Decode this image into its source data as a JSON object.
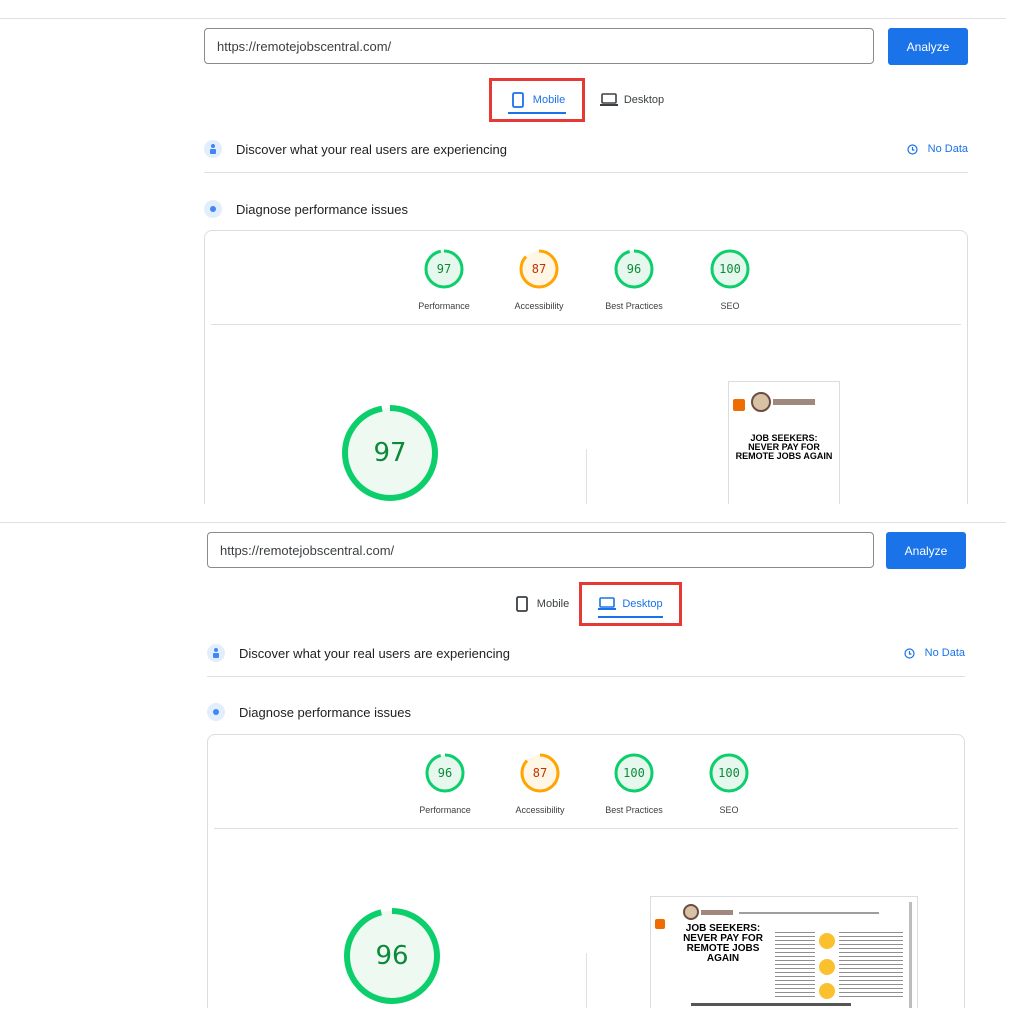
{
  "panels": [
    {
      "url": "https://remotejobscentral.com/",
      "analyze_label": "Analyze",
      "tabs": {
        "mobile": "Mobile",
        "desktop": "Desktop",
        "active": "mobile"
      },
      "sections": {
        "discover": "Discover what your real users are experiencing",
        "no_data": "No Data",
        "diagnose": "Diagnose performance issues"
      },
      "categories": [
        {
          "label": "Performance",
          "score": "97",
          "status": "good"
        },
        {
          "label": "Accessibility",
          "score": "87",
          "status": "average"
        },
        {
          "label": "Best Practices",
          "score": "96",
          "status": "good"
        },
        {
          "label": "SEO",
          "score": "100",
          "status": "good"
        }
      ],
      "big_score": "97",
      "screenshot": {
        "headline": "JOB SEEKERS: NEVER PAY FOR REMOTE JOBS AGAIN"
      }
    },
    {
      "url": "https://remotejobscentral.com/",
      "analyze_label": "Analyze",
      "tabs": {
        "mobile": "Mobile",
        "desktop": "Desktop",
        "active": "desktop"
      },
      "sections": {
        "discover": "Discover what your real users are experiencing",
        "no_data": "No Data",
        "diagnose": "Diagnose performance issues"
      },
      "categories": [
        {
          "label": "Performance",
          "score": "96",
          "status": "good"
        },
        {
          "label": "Accessibility",
          "score": "87",
          "status": "average"
        },
        {
          "label": "Best Practices",
          "score": "100",
          "status": "good"
        },
        {
          "label": "SEO",
          "score": "100",
          "status": "good"
        }
      ],
      "big_score": "96",
      "screenshot": {
        "headline": "JOB SEEKERS: NEVER PAY FOR REMOTE JOBS AGAIN"
      }
    }
  ],
  "colors": {
    "accent": "#1a73e8",
    "highlight_box": "#e53935",
    "good": "#0cce6b",
    "average": "#ffa400"
  }
}
